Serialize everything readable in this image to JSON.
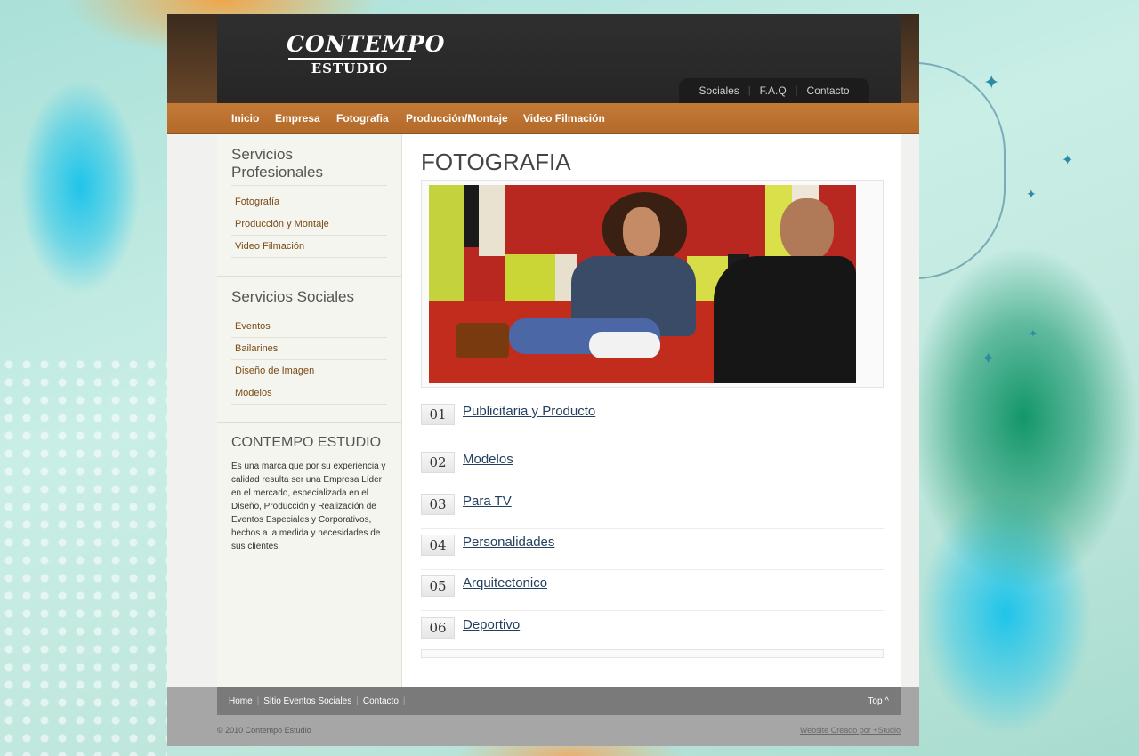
{
  "logo": {
    "line1": "CONTEMPO",
    "line2": "ESTUDIO"
  },
  "top_links": [
    "Sociales",
    "F.A.Q",
    "Contacto"
  ],
  "top_links_separator": "|",
  "nav": [
    "Inicio",
    "Empresa",
    "Fotografia",
    "Producción/Montaje",
    "Video Filmación"
  ],
  "sidebar": {
    "profesionales": {
      "title": "Servicios Profesionales",
      "items": [
        "Fotografía",
        "Producción y Montaje",
        "Video Filmación"
      ]
    },
    "sociales": {
      "title": "Servicios Sociales",
      "items": [
        "Eventos",
        "Bailarines",
        "Diseño de Imagen",
        "Modelos"
      ]
    },
    "about": {
      "title": "CONTEMPO ESTUDIO",
      "text": "Es una marca que por su experiencia y calidad resulta ser una Empresa Líder en el mercado, especializada en el Diseño, Producción y Realización de Eventos Especiales y Corporativos, hechos a la medida y necesidades de sus clientes."
    }
  },
  "main": {
    "title": "FOTOGRAFIA",
    "items": [
      {
        "num": "01",
        "label": "Publicitaria y Producto"
      },
      {
        "num": "02",
        "label": "Modelos"
      },
      {
        "num": "03",
        "label": "Para TV"
      },
      {
        "num": "04",
        "label": "Personalidades"
      },
      {
        "num": "05",
        "label": "Arquitectonico"
      },
      {
        "num": "06",
        "label": "Deportivo"
      }
    ]
  },
  "footer": {
    "links": [
      "Home",
      "Sitio Eventos Sociales",
      "Contacto"
    ],
    "separator": "|",
    "top": "Top ^",
    "copyright": "© 2010 Contempo Estudio",
    "credit": "Website Creado por +Studio"
  },
  "colors": {
    "accent": "#b8702f",
    "link": "#23415e",
    "sidebar_link": "#7a4a14"
  }
}
